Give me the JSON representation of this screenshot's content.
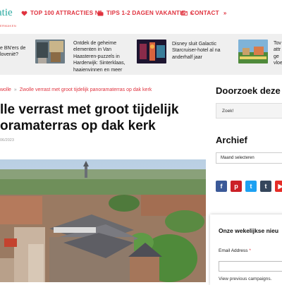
{
  "header": {
    "logo_text": "atie",
    "logo_sub": "ERMAKEN",
    "nav": [
      {
        "label": "TOP 100 ATTRACTIES NL",
        "icon": "heart-icon"
      },
      {
        "label": "TIPS 1-2 DAGEN VAKANTIE",
        "icon": "suitcase-icon"
      },
      {
        "label": "CONTACT",
        "icon": "envelope-icon"
      }
    ],
    "chevron": "»"
  },
  "teasers": [
    {
      "text_lines": [
        "e BN'ers de",
        "lovenië?"
      ]
    },
    {
      "text_lines": [
        "Ontdek de geheime",
        "elementen in Van",
        "Haasteren-puzzels in",
        "Harderwijk: Sinterklaas,",
        "haaienvinnen en meer"
      ]
    },
    {
      "text_lines": [
        "Disney sluit Galactic",
        "Starcruiser-hotel al na",
        "anderhalf jaar"
      ]
    },
    {
      "text_lines": [
        "Tov",
        "attr",
        "ge",
        "vloe"
      ]
    }
  ],
  "breadcrumb": {
    "items": [
      "wolle",
      "Zwolle verrast met groot tijdelijk panoramaterras op dak kerk"
    ],
    "separator": "»"
  },
  "article": {
    "title_lines": [
      "lle verrast met groot tijdelijk",
      "oramaterras op dak kerk"
    ],
    "date": "06/2023"
  },
  "sidebar": {
    "search_heading": "Doorzoek deze",
    "search_placeholder": "Zoek!",
    "archive_heading": "Archief",
    "archive_select": "Maand selecteren",
    "social": [
      {
        "name": "facebook",
        "glyph": "f",
        "color": "#3b5998"
      },
      {
        "name": "pinterest",
        "glyph": "p",
        "color": "#cb2027"
      },
      {
        "name": "twitter",
        "glyph": "t",
        "color": "#1da1f2"
      },
      {
        "name": "tumblr",
        "glyph": "t",
        "color": "#35465c"
      },
      {
        "name": "youtube",
        "glyph": "▶",
        "color": "#e52d27"
      }
    ]
  },
  "newsletter": {
    "title": "Onze wekelijkse nieu",
    "email_label": "Email Address",
    "required_mark": "*",
    "previous_campaigns": "View previous campaigns."
  },
  "colors": {
    "accent": "#e0323e",
    "logo": "#2aa9a0",
    "teaser_bg": "#efefef"
  }
}
